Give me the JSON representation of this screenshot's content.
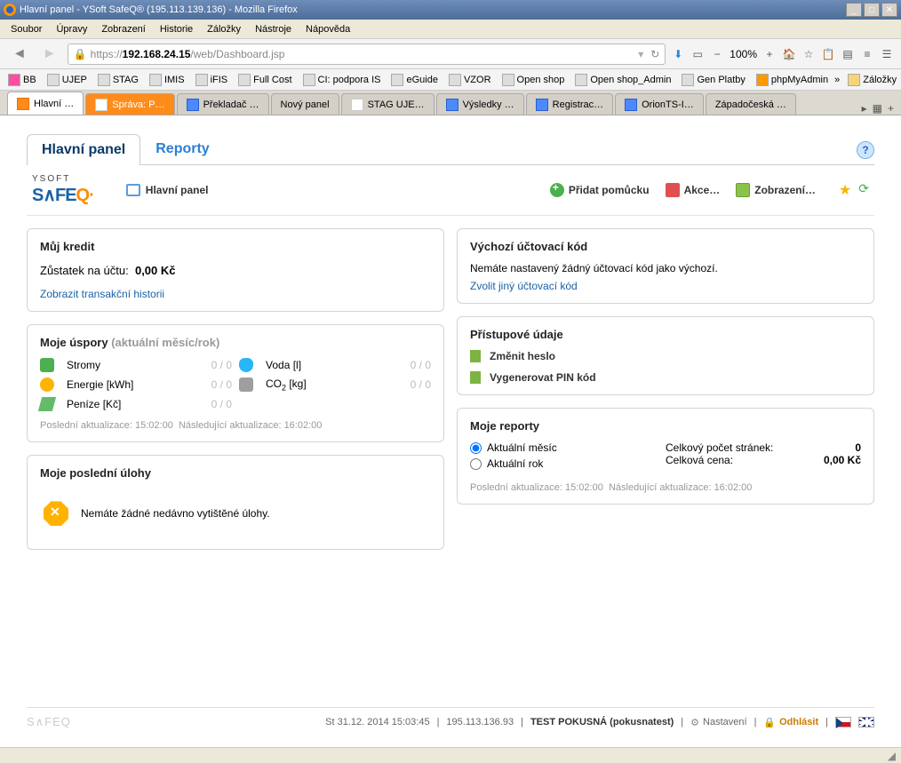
{
  "window": {
    "title": "Hlavní panel - YSoft SafeQ® (195.113.139.136) - Mozilla Firefox"
  },
  "menubar": [
    "Soubor",
    "Úpravy",
    "Zobrazení",
    "Historie",
    "Záložky",
    "Nástroje",
    "Nápověda"
  ],
  "url": {
    "prefix": "https://",
    "host": "192.168.24.15",
    "path": "/web/Dashboard.jsp"
  },
  "zoom": "100%",
  "bookmarks": [
    "BB",
    "UJEP",
    "STAG",
    "IMIS",
    "iFIS",
    "Full Cost",
    "CI: podpora IS",
    "eGuide",
    "VZOR",
    "Open shop",
    "Open shop_Admin",
    "Gen Platby",
    "phpMyAdmin"
  ],
  "bookmarks_right": "Záložky",
  "tabs": [
    "Hlavní …",
    "Správa: P…",
    "Překladač …",
    "Nový panel",
    "STAG UJE…",
    "Výsledky …",
    "Registrac…",
    "OrionTS-I…",
    "Západočeská …"
  ],
  "apptabs": {
    "main": "Hlavní panel",
    "reports": "Reporty"
  },
  "subbar": {
    "title": "Hlavní panel",
    "add": "Přidat pomůcku",
    "actions": "Akce…",
    "view": "Zobrazení…"
  },
  "credit": {
    "title": "Můj kredit",
    "balance_lbl": "Zůstatek na účtu:",
    "balance_val": "0,00 Kč",
    "history": "Zobrazit transakční historii"
  },
  "savings": {
    "title": "Moje úspory",
    "sub": "(aktuální měsíc/rok)",
    "rows": {
      "trees": "Stromy",
      "energy": "Energie [kWh]",
      "money": "Peníze [Kč]",
      "water": "Voda [l]",
      "co2": "CO2 [kg]"
    },
    "val": "0 / 0",
    "last": "Poslední aktualizace: 15:02:00",
    "next": "Následující aktualizace: 16:02:00"
  },
  "jobs": {
    "title": "Moje poslední úlohy",
    "msg": "Nemáte žádné nedávno vytištěné úlohy."
  },
  "billingcode": {
    "title": "Výchozí účtovací kód",
    "msg": "Nemáte nastavený žádný účtovací kód jako výchozí.",
    "link": "Zvolit jiný účtovací kód"
  },
  "access": {
    "title": "Přístupové údaje",
    "pw": "Změnit heslo",
    "pin": "Vygenerovat PIN kód"
  },
  "reports": {
    "title": "Moje reporty",
    "month": "Aktuální měsíc",
    "year": "Aktuální rok",
    "pages_lbl": "Celkový počet stránek:",
    "pages_val": "0",
    "price_lbl": "Celková cena:",
    "price_val": "0,00 Kč",
    "last": "Poslední aktualizace: 15:02:00",
    "next": "Následující aktualizace: 16:02:00"
  },
  "footer": {
    "date": "St 31.12. 2014 15:03:45",
    "ip": "195.113.136.93",
    "user": "TEST POKUSNÁ (pokusnatest)",
    "settings": "Nastavení",
    "logout": "Odhlásit"
  }
}
